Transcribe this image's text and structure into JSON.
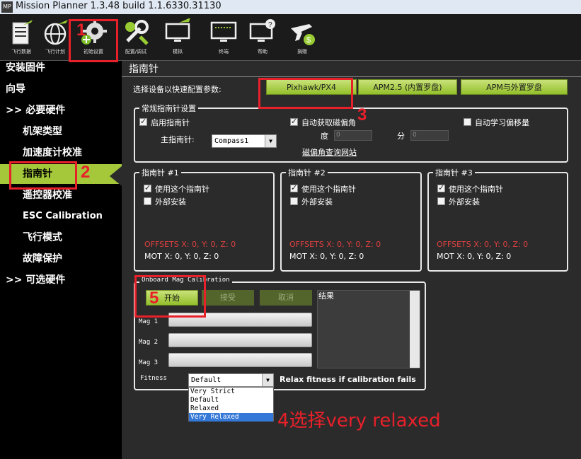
{
  "titlebar": {
    "logo": "MP",
    "title": "Mission Planner 1.3.48 build 1.1.6330.31130"
  },
  "toolbar": {
    "items": [
      {
        "label": "飞行数据",
        "icon": "flight-data-icon"
      },
      {
        "label": "飞行计划",
        "icon": "flight-plan-icon"
      },
      {
        "label": "初始设置",
        "icon": "initial-setup-icon"
      },
      {
        "label": "配置/调试",
        "icon": "config-tuning-icon"
      },
      {
        "label": "模拟",
        "icon": "simulation-icon"
      },
      {
        "label": "终端",
        "icon": "terminal-icon"
      },
      {
        "label": "帮助",
        "icon": "help-icon"
      },
      {
        "label": "捐赠",
        "icon": "donate-icon"
      }
    ]
  },
  "sidebar": {
    "items": [
      {
        "label": "安装固件"
      },
      {
        "label": "向导"
      },
      {
        "label": ">> 必要硬件"
      },
      {
        "label": "机架类型"
      },
      {
        "label": "加速度计校准"
      },
      {
        "label": "指南针"
      },
      {
        "label": "遥控器校准"
      },
      {
        "label": "ESC Calibration"
      },
      {
        "label": "飞行模式"
      },
      {
        "label": "故障保护"
      },
      {
        "label": ">> 可选硬件"
      }
    ]
  },
  "main": {
    "title": "指南针",
    "preset_label": "选择设备以快速配置参数:",
    "preset_buttons": [
      "Pixhawk/PX4",
      "APM2.5 (内置罗盘)",
      "APM与外置罗盘"
    ],
    "general": {
      "title": "常规指南针设置",
      "enable_label": "启用指南针",
      "auto_dec_label": "自动获取磁偏角",
      "auto_learn_label": "自动学习偏移量",
      "primary_label": "主指南针:",
      "primary_value": "Compass1",
      "deg_label": "度",
      "deg_value": "0",
      "min_label": "分",
      "min_value": "0",
      "link_label": "磁偏角查询网站"
    },
    "compasses": [
      {
        "title": "指南针 #1",
        "use_label": "使用这个指南针",
        "ext_label": "外部安装",
        "offsets": "OFFSETS  X: 0,    Y: 0,    Z: 0",
        "mot": "MOT          X: 0,    Y: 0,    Z: 0"
      },
      {
        "title": "指南针 #2",
        "use_label": "使用这个指南针",
        "ext_label": "外部安装",
        "offsets": "OFFSETS  X: 0,    Y: 0,    Z: 0",
        "mot": "MOT          X: 0,    Y: 0,    Z: 0"
      },
      {
        "title": "指南针 #3",
        "use_label": "使用这个指南针",
        "ext_label": "外部安装",
        "offsets": "OFFSETS  X: 0,    Y: 0,    Z: 0",
        "mot": "MOT          X: 0,    Y: 0,    Z: 0"
      }
    ],
    "onboard": {
      "title": "Onboard Mag Calibration",
      "start_label": "开始",
      "accept_label": "接受",
      "cancel_label": "取消",
      "result_label": "结果",
      "mag_labels": [
        "Mag 1",
        "Mag 2",
        "Mag 3"
      ],
      "fitness_label": "Fitness",
      "fitness_value": "Default",
      "fitness_options": [
        "Very Strict",
        "Default",
        "Relaxed",
        "Very Relaxed"
      ],
      "relax_label": "Relax fitness if calibration fails"
    }
  },
  "annotations": {
    "step1": "1",
    "step2": "2",
    "step3": "3",
    "step4": "4选择very relaxed",
    "step5": "5"
  },
  "colors": {
    "accent": "#a4c83a",
    "annotation": "#e8202a",
    "offsets": "#e04040"
  }
}
